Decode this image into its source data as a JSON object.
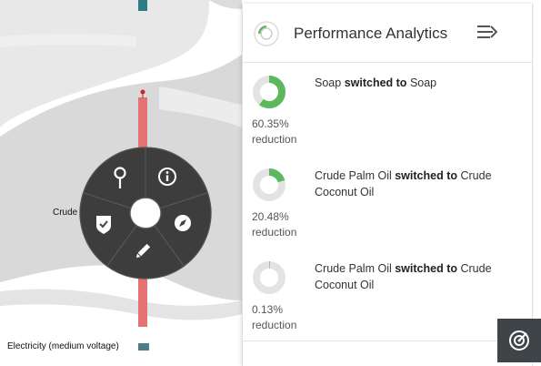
{
  "diagram": {
    "node_labels": {
      "crude": "Crude",
      "electricity": "Electricity (medium voltage)"
    }
  },
  "radial_menu": {
    "items": [
      "search-pin-icon",
      "info-icon",
      "compass-icon",
      "edit-pencil-icon",
      "shield-check-icon"
    ]
  },
  "panel": {
    "title": "Performance Analytics",
    "switch_word": "switched to",
    "reduction_word": "reduction",
    "accent_color": "#5cb85c",
    "items": [
      {
        "from": "Soap",
        "to": "Soap",
        "percent_label": "60.35%",
        "fraction": 0.6035
      },
      {
        "from": "Crude Palm Oil",
        "to": "Crude Coconut Oil",
        "percent_label": "20.48%",
        "fraction": 0.2048
      },
      {
        "from": "Crude Palm Oil",
        "to": "Crude Coconut Oil",
        "percent_label": "0.13%",
        "fraction": 0.0013
      }
    ]
  }
}
